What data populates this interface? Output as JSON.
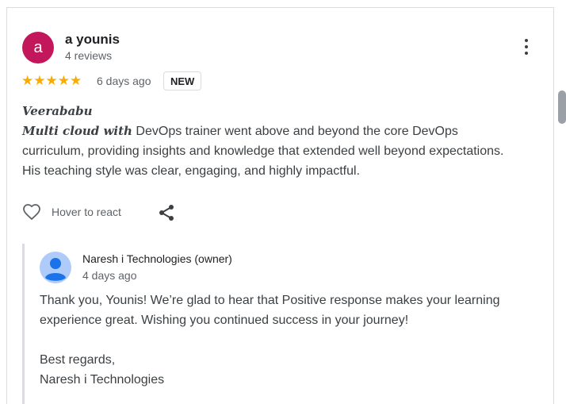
{
  "review": {
    "avatar_letter": "a",
    "avatar_color": "#c2185b",
    "name": "a younis",
    "reviews_count": "4 reviews",
    "stars": "★★★★★",
    "rating": 5,
    "date": "6 days ago",
    "badge": "NEW",
    "text_line1": "Veerababu",
    "text_line2_styled": "Multi cloud with",
    "text_rest": " DevOps trainer went above and beyond the core DevOps curriculum, providing insights and knowledge that extended well beyond expectations. His teaching style was clear, engaging, and highly impactful."
  },
  "actions": {
    "react_icon": "heart-outline-icon",
    "react_label": "Hover to react",
    "share_icon": "share-icon",
    "more_icon": "more-vert-icon"
  },
  "reply": {
    "owner_icon": "person-avatar-icon",
    "owner_name": "Naresh i Technologies (owner)",
    "date": "4 days ago",
    "paragraph1": "Thank you, Younis! We’re glad to hear that Positive response makes your learning experience great. Wishing you continued success in your journey!",
    "signoff": "Best regards,",
    "signature": "Naresh i Technologies"
  },
  "colors": {
    "star": "#f9ab00",
    "muted_text": "#5f6368",
    "body_text": "#3c4043"
  }
}
